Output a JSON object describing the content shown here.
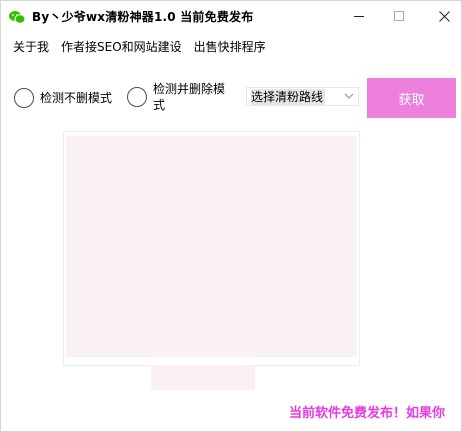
{
  "window": {
    "title": "By丶少爷wx清粉神器1.0 当前免费发布",
    "icon": "wechat-icon",
    "controls": [
      "minimize",
      "maximize",
      "close"
    ]
  },
  "menu": {
    "items": [
      {
        "label": "关于我"
      },
      {
        "label": "作者接SEO和网站建设"
      },
      {
        "label": "出售快排程序"
      }
    ]
  },
  "options": {
    "radio_check_only": {
      "label": "检测不删模式",
      "checked": false
    },
    "radio_check_delete": {
      "label": "检测并删除模式",
      "checked": false
    },
    "route_select": {
      "value": "选择清粉路线"
    },
    "get_button": {
      "label": "获取"
    }
  },
  "footer": {
    "marquee_text": "当前软件免费发布！如果你"
  },
  "colors": {
    "accent": "#ec80dc",
    "marquee": "#e63ce0",
    "panel_bg": "#f9f1f5"
  }
}
